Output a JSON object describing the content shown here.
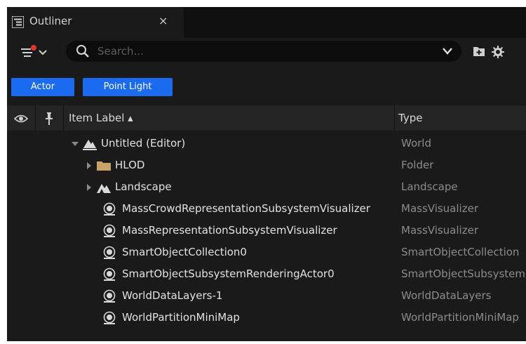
{
  "tab": {
    "title": "Outliner",
    "close": "×"
  },
  "toolbar": {
    "search_placeholder": "Search...",
    "filter_icon": "filter-icon",
    "add_folder_icon": "add-folder-icon",
    "settings_icon": "gear-icon"
  },
  "chips": [
    {
      "label": "Actor"
    },
    {
      "label": "Point Light"
    }
  ],
  "header": {
    "visibility_icon": "eye-icon",
    "pin_icon": "pin-icon",
    "item_label": "Item Label ▴",
    "type": "Type"
  },
  "rows": [
    {
      "label": "Untitled (Editor)",
      "type": "World",
      "icon": "world-icon",
      "expanded": true
    },
    {
      "label": "HLOD",
      "type": "Folder",
      "icon": "folder-icon",
      "expanded": false
    },
    {
      "label": "Landscape",
      "type": "Landscape",
      "icon": "landscape-icon",
      "expanded": false
    },
    {
      "label": "MassCrowdRepresentationSubsystemVisualizer",
      "type": "MassVisualizer",
      "icon": "actor-icon"
    },
    {
      "label": "MassRepresentationSubsystemVisualizer",
      "type": "MassVisualizer",
      "icon": "actor-icon"
    },
    {
      "label": "SmartObjectCollection0",
      "type": "SmartObjectCollection",
      "icon": "actor-icon"
    },
    {
      "label": "SmartObjectSubsystemRenderingActor0",
      "type": "SmartObjectSubsystemRenderingActor",
      "icon": "actor-icon"
    },
    {
      "label": "WorldDataLayers-1",
      "type": "WorldDataLayers",
      "icon": "actor-icon"
    },
    {
      "label": "WorldPartitionMiniMap",
      "type": "WorldPartitionMiniMap",
      "icon": "actor-icon"
    }
  ],
  "colors": {
    "panel_bg": "#1a1a1a",
    "chip_blue": "#1a6bf0",
    "folder": "#c8a268",
    "filter_dot": "#e8322c"
  }
}
